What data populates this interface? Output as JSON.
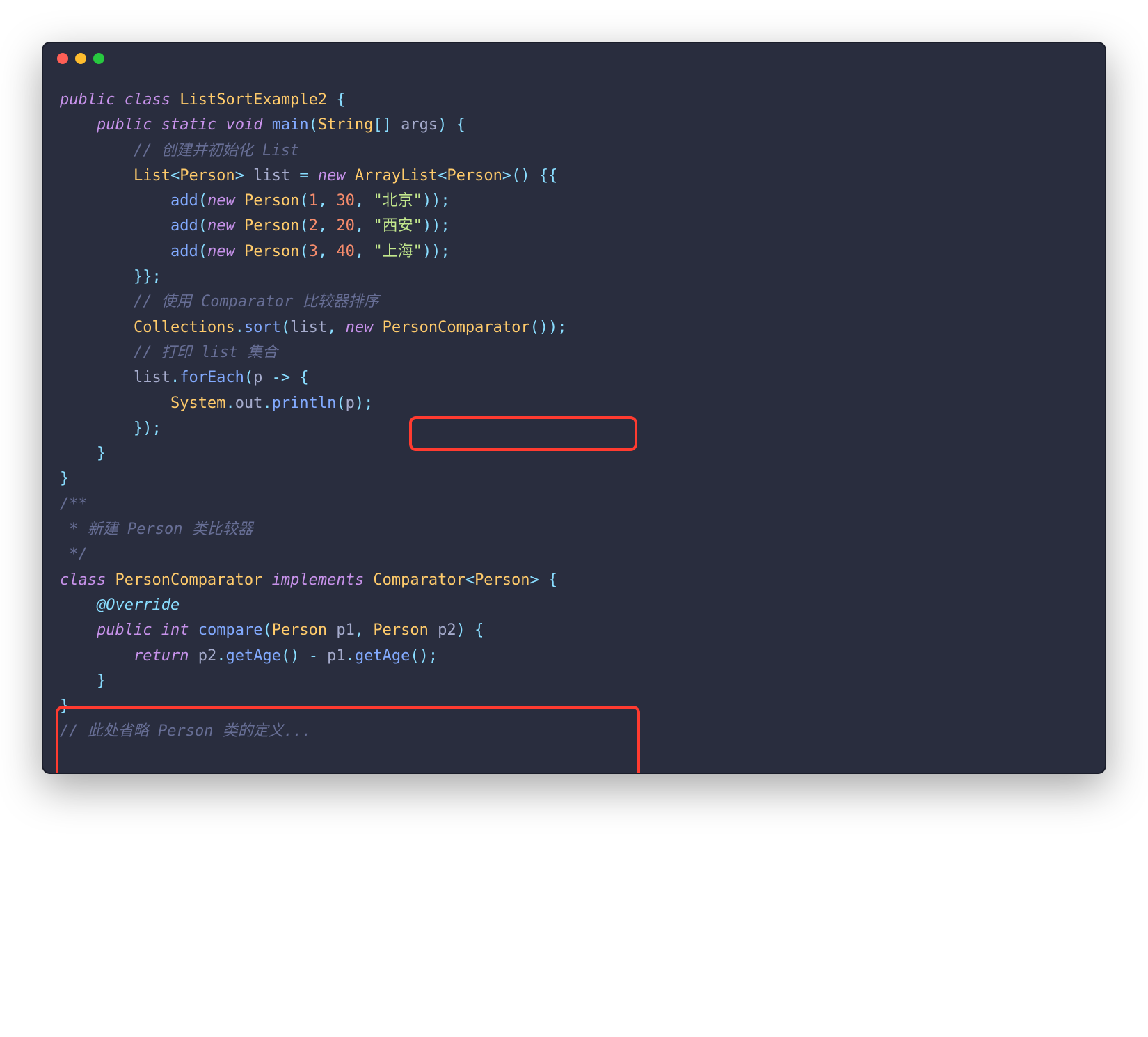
{
  "window": {
    "traffic_lights": [
      "close",
      "minimize",
      "zoom"
    ]
  },
  "code": {
    "tokens": [
      [
        {
          "c": "kw",
          "t": "public"
        },
        {
          "c": "plain",
          "t": " "
        },
        {
          "c": "kw",
          "t": "class"
        },
        {
          "c": "plain",
          "t": " "
        },
        {
          "c": "type",
          "t": "ListSortExample2"
        },
        {
          "c": "plain",
          "t": " "
        },
        {
          "c": "punc",
          "t": "{"
        }
      ],
      [
        {
          "c": "plain",
          "t": "    "
        },
        {
          "c": "kw",
          "t": "public"
        },
        {
          "c": "plain",
          "t": " "
        },
        {
          "c": "kw",
          "t": "static"
        },
        {
          "c": "plain",
          "t": " "
        },
        {
          "c": "kw",
          "t": "void"
        },
        {
          "c": "plain",
          "t": " "
        },
        {
          "c": "fn",
          "t": "main"
        },
        {
          "c": "punc",
          "t": "("
        },
        {
          "c": "type",
          "t": "String"
        },
        {
          "c": "punc",
          "t": "[]"
        },
        {
          "c": "plain",
          "t": " args"
        },
        {
          "c": "punc",
          "t": ")"
        },
        {
          "c": "plain",
          "t": " "
        },
        {
          "c": "punc",
          "t": "{"
        }
      ],
      [
        {
          "c": "plain",
          "t": "        "
        },
        {
          "c": "cmt",
          "t": "// 创建并初始化 List"
        }
      ],
      [
        {
          "c": "plain",
          "t": "        "
        },
        {
          "c": "type",
          "t": "List"
        },
        {
          "c": "punc",
          "t": "<"
        },
        {
          "c": "type",
          "t": "Person"
        },
        {
          "c": "punc",
          "t": ">"
        },
        {
          "c": "plain",
          "t": " list "
        },
        {
          "c": "op",
          "t": "="
        },
        {
          "c": "plain",
          "t": " "
        },
        {
          "c": "kw",
          "t": "new"
        },
        {
          "c": "plain",
          "t": " "
        },
        {
          "c": "type",
          "t": "ArrayList"
        },
        {
          "c": "punc",
          "t": "<"
        },
        {
          "c": "type",
          "t": "Person"
        },
        {
          "c": "punc",
          "t": ">()"
        },
        {
          "c": "plain",
          "t": " "
        },
        {
          "c": "punc",
          "t": "{{"
        }
      ],
      [
        {
          "c": "plain",
          "t": "            "
        },
        {
          "c": "fn",
          "t": "add"
        },
        {
          "c": "punc",
          "t": "("
        },
        {
          "c": "kw",
          "t": "new"
        },
        {
          "c": "plain",
          "t": " "
        },
        {
          "c": "type",
          "t": "Person"
        },
        {
          "c": "punc",
          "t": "("
        },
        {
          "c": "num",
          "t": "1"
        },
        {
          "c": "punc",
          "t": ","
        },
        {
          "c": "plain",
          "t": " "
        },
        {
          "c": "num",
          "t": "30"
        },
        {
          "c": "punc",
          "t": ","
        },
        {
          "c": "plain",
          "t": " "
        },
        {
          "c": "str",
          "t": "\"北京\""
        },
        {
          "c": "punc",
          "t": "));"
        }
      ],
      [
        {
          "c": "plain",
          "t": "            "
        },
        {
          "c": "fn",
          "t": "add"
        },
        {
          "c": "punc",
          "t": "("
        },
        {
          "c": "kw",
          "t": "new"
        },
        {
          "c": "plain",
          "t": " "
        },
        {
          "c": "type",
          "t": "Person"
        },
        {
          "c": "punc",
          "t": "("
        },
        {
          "c": "num",
          "t": "2"
        },
        {
          "c": "punc",
          "t": ","
        },
        {
          "c": "plain",
          "t": " "
        },
        {
          "c": "num",
          "t": "20"
        },
        {
          "c": "punc",
          "t": ","
        },
        {
          "c": "plain",
          "t": " "
        },
        {
          "c": "str",
          "t": "\"西安\""
        },
        {
          "c": "punc",
          "t": "));"
        }
      ],
      [
        {
          "c": "plain",
          "t": "            "
        },
        {
          "c": "fn",
          "t": "add"
        },
        {
          "c": "punc",
          "t": "("
        },
        {
          "c": "kw",
          "t": "new"
        },
        {
          "c": "plain",
          "t": " "
        },
        {
          "c": "type",
          "t": "Person"
        },
        {
          "c": "punc",
          "t": "("
        },
        {
          "c": "num",
          "t": "3"
        },
        {
          "c": "punc",
          "t": ","
        },
        {
          "c": "plain",
          "t": " "
        },
        {
          "c": "num",
          "t": "40"
        },
        {
          "c": "punc",
          "t": ","
        },
        {
          "c": "plain",
          "t": " "
        },
        {
          "c": "str",
          "t": "\"上海\""
        },
        {
          "c": "punc",
          "t": "));"
        }
      ],
      [
        {
          "c": "plain",
          "t": "        "
        },
        {
          "c": "punc",
          "t": "}};"
        }
      ],
      [
        {
          "c": "plain",
          "t": "        "
        },
        {
          "c": "cmt",
          "t": "// 使用 Comparator 比较器排序"
        }
      ],
      [
        {
          "c": "plain",
          "t": "        "
        },
        {
          "c": "type",
          "t": "Collections"
        },
        {
          "c": "punc",
          "t": "."
        },
        {
          "c": "fn",
          "t": "sort"
        },
        {
          "c": "punc",
          "t": "("
        },
        {
          "c": "plain",
          "t": "list"
        },
        {
          "c": "punc",
          "t": ","
        },
        {
          "c": "plain",
          "t": " "
        },
        {
          "c": "kw",
          "t": "new"
        },
        {
          "c": "plain",
          "t": " "
        },
        {
          "c": "type",
          "t": "PersonComparator"
        },
        {
          "c": "punc",
          "t": "());"
        }
      ],
      [
        {
          "c": "plain",
          "t": "        "
        },
        {
          "c": "cmt",
          "t": "// 打印 list 集合"
        }
      ],
      [
        {
          "c": "plain",
          "t": "        list"
        },
        {
          "c": "punc",
          "t": "."
        },
        {
          "c": "fn",
          "t": "forEach"
        },
        {
          "c": "punc",
          "t": "("
        },
        {
          "c": "plain",
          "t": "p "
        },
        {
          "c": "op",
          "t": "->"
        },
        {
          "c": "plain",
          "t": " "
        },
        {
          "c": "punc",
          "t": "{"
        }
      ],
      [
        {
          "c": "plain",
          "t": "            "
        },
        {
          "c": "type",
          "t": "System"
        },
        {
          "c": "punc",
          "t": "."
        },
        {
          "c": "plain",
          "t": "out"
        },
        {
          "c": "punc",
          "t": "."
        },
        {
          "c": "fn",
          "t": "println"
        },
        {
          "c": "punc",
          "t": "("
        },
        {
          "c": "plain",
          "t": "p"
        },
        {
          "c": "punc",
          "t": ");"
        }
      ],
      [
        {
          "c": "plain",
          "t": "        "
        },
        {
          "c": "punc",
          "t": "});"
        }
      ],
      [
        {
          "c": "plain",
          "t": "    "
        },
        {
          "c": "punc",
          "t": "}"
        }
      ],
      [
        {
          "c": "punc",
          "t": "}"
        }
      ],
      [
        {
          "c": "cmt",
          "t": "/**"
        }
      ],
      [
        {
          "c": "cmt",
          "t": " * 新建 Person 类比较器"
        }
      ],
      [
        {
          "c": "cmt",
          "t": " */"
        }
      ],
      [
        {
          "c": "kw",
          "t": "class"
        },
        {
          "c": "plain",
          "t": " "
        },
        {
          "c": "type",
          "t": "PersonComparator"
        },
        {
          "c": "plain",
          "t": " "
        },
        {
          "c": "kw",
          "t": "implements"
        },
        {
          "c": "plain",
          "t": " "
        },
        {
          "c": "type",
          "t": "Comparator"
        },
        {
          "c": "punc",
          "t": "<"
        },
        {
          "c": "type",
          "t": "Person"
        },
        {
          "c": "punc",
          "t": ">"
        },
        {
          "c": "plain",
          "t": " "
        },
        {
          "c": "punc",
          "t": "{"
        }
      ],
      [
        {
          "c": "plain",
          "t": "    "
        },
        {
          "c": "ann",
          "t": "@Override"
        }
      ],
      [
        {
          "c": "plain",
          "t": "    "
        },
        {
          "c": "kw",
          "t": "public"
        },
        {
          "c": "plain",
          "t": " "
        },
        {
          "c": "kw",
          "t": "int"
        },
        {
          "c": "plain",
          "t": " "
        },
        {
          "c": "fn",
          "t": "compare"
        },
        {
          "c": "punc",
          "t": "("
        },
        {
          "c": "type",
          "t": "Person"
        },
        {
          "c": "plain",
          "t": " p1"
        },
        {
          "c": "punc",
          "t": ","
        },
        {
          "c": "plain",
          "t": " "
        },
        {
          "c": "type",
          "t": "Person"
        },
        {
          "c": "plain",
          "t": " p2"
        },
        {
          "c": "punc",
          "t": ")"
        },
        {
          "c": "plain",
          "t": " "
        },
        {
          "c": "punc",
          "t": "{"
        }
      ],
      [
        {
          "c": "plain",
          "t": "        "
        },
        {
          "c": "kw",
          "t": "return"
        },
        {
          "c": "plain",
          "t": " p2"
        },
        {
          "c": "punc",
          "t": "."
        },
        {
          "c": "fn",
          "t": "getAge"
        },
        {
          "c": "punc",
          "t": "()"
        },
        {
          "c": "plain",
          "t": " "
        },
        {
          "c": "op",
          "t": "-"
        },
        {
          "c": "plain",
          "t": " p1"
        },
        {
          "c": "punc",
          "t": "."
        },
        {
          "c": "fn",
          "t": "getAge"
        },
        {
          "c": "punc",
          "t": "();"
        }
      ],
      [
        {
          "c": "plain",
          "t": "    "
        },
        {
          "c": "punc",
          "t": "}"
        }
      ],
      [
        {
          "c": "punc",
          "t": "}"
        }
      ],
      [
        {
          "c": "cmt",
          "t": "// 此处省略 Person 类的定义..."
        }
      ]
    ]
  },
  "highlights": [
    {
      "desc": "new PersonComparator() call"
    },
    {
      "desc": "PersonComparator class body"
    }
  ],
  "colors": {
    "bg": "#292d3e",
    "keyword": "#c792ea",
    "type": "#ffcb6b",
    "function": "#82aaff",
    "string": "#c3e88d",
    "number": "#f78c6c",
    "comment": "#676e95",
    "punct": "#89ddff",
    "text": "#a6accd",
    "highlight_border": "#ff3b30"
  }
}
